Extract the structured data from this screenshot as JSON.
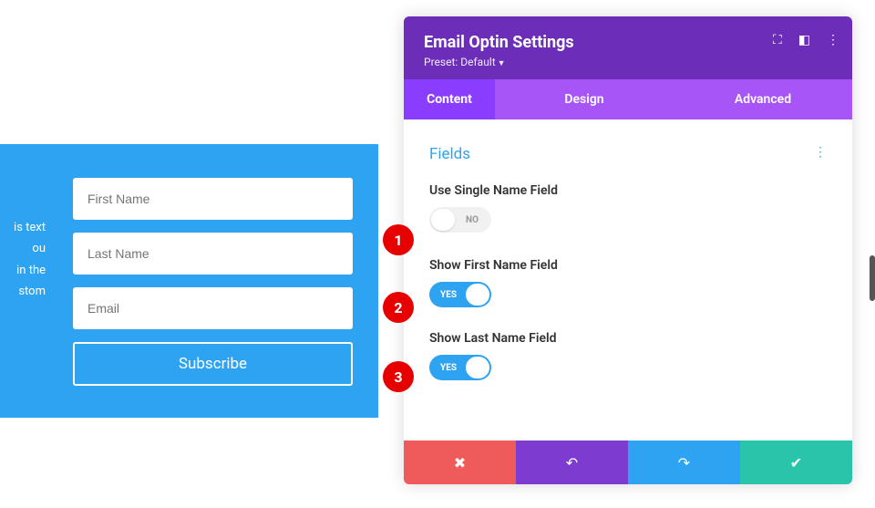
{
  "preview": {
    "text_lines": [
      "is text",
      "ou",
      "in the",
      "stom"
    ],
    "first_name_ph": "First Name",
    "last_name_ph": "Last Name",
    "email_ph": "Email",
    "subscribe": "Subscribe"
  },
  "panel": {
    "title": "Email Optin Settings",
    "preset_label": "Preset: Default",
    "tabs": {
      "content": "Content",
      "design": "Design",
      "advanced": "Advanced"
    },
    "section": "Fields",
    "fields": {
      "single": {
        "label": "Use Single Name Field",
        "value": "NO"
      },
      "first": {
        "label": "Show First Name Field",
        "value": "YES"
      },
      "last": {
        "label": "Show Last Name Field",
        "value": "YES"
      }
    }
  },
  "badges": {
    "b1": "1",
    "b2": "2",
    "b3": "3"
  }
}
